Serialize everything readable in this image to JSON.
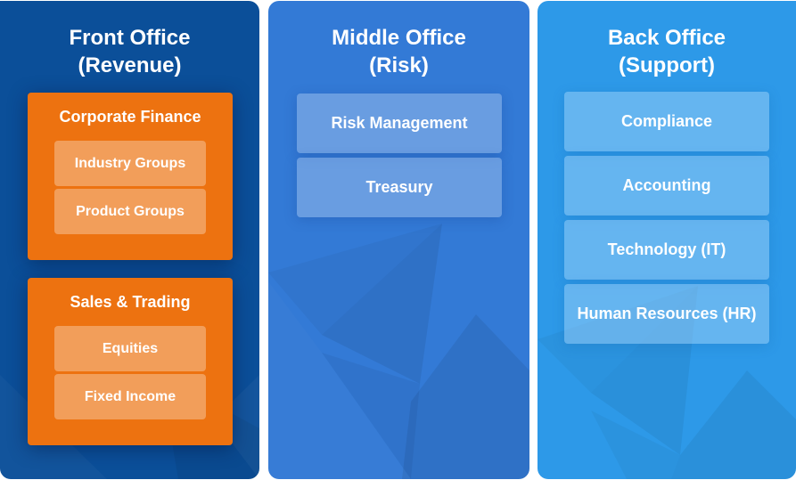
{
  "diagram": {
    "panels": [
      {
        "title_line1": "Front Office",
        "title_line2": "(Revenue)",
        "color": "#0b4f99",
        "groups": [
          {
            "title": "Corporate Finance",
            "items": [
              "Industry Groups",
              "Product Groups"
            ]
          },
          {
            "title": "Sales & Trading",
            "items": [
              "Equities",
              "Fixed Income"
            ]
          }
        ]
      },
      {
        "title_line1": "Middle Office",
        "title_line2": "(Risk)",
        "color": "#337ad6",
        "items": [
          "Risk Management",
          "Treasury"
        ]
      },
      {
        "title_line1": "Back Office",
        "title_line2": "(Support)",
        "color": "#2d99e8",
        "items": [
          "Compliance",
          "Accounting",
          "Technology (IT)",
          "Human Resources (HR)"
        ]
      }
    ],
    "group_color": "#ed7210",
    "subitem_color": "#f29e5a"
  }
}
